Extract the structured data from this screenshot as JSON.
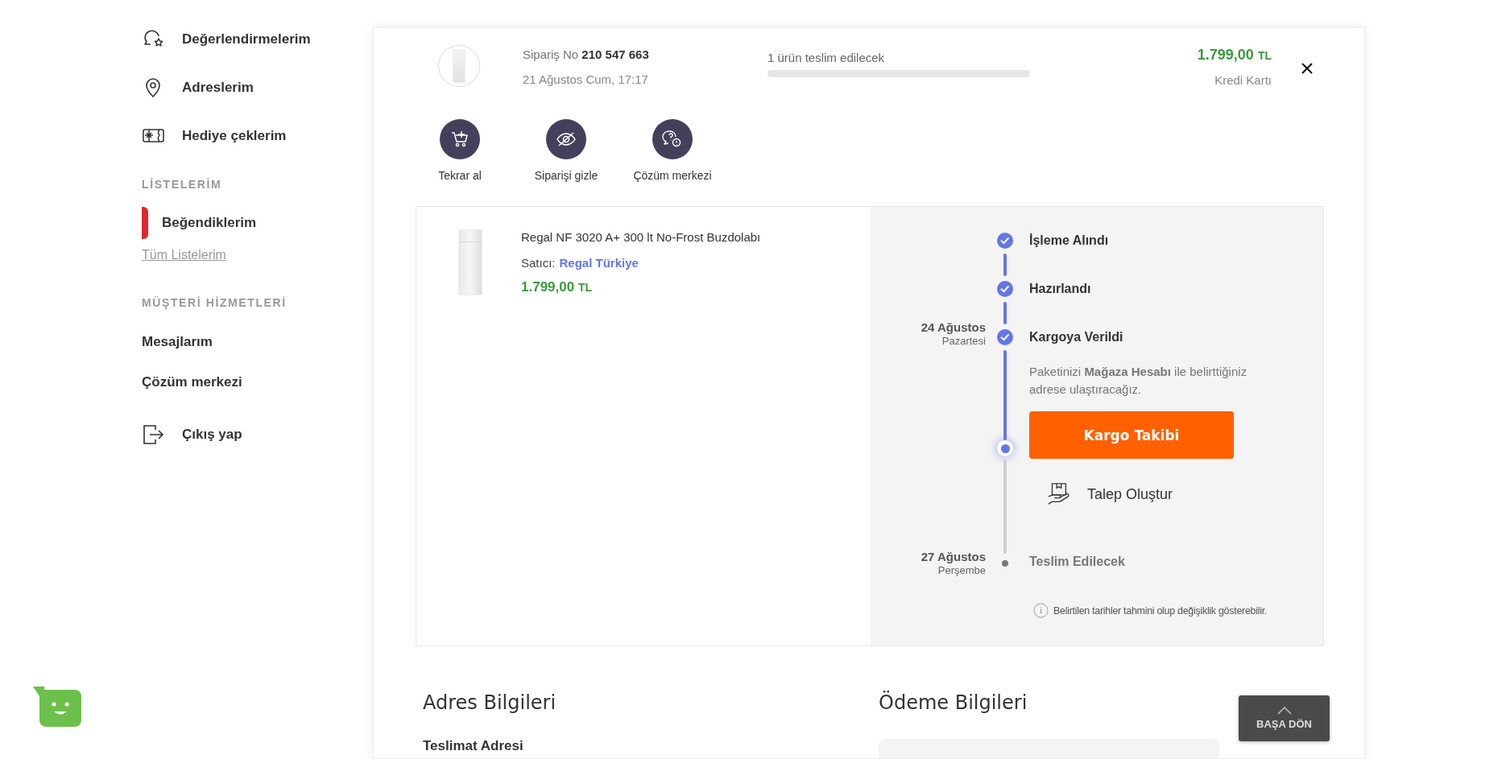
{
  "sidebar": [
    {
      "kind": "icon-item",
      "label": "Değerlendirmelerim"
    },
    {
      "kind": "icon-item",
      "label": "Adreslerim"
    },
    {
      "kind": "icon-item",
      "label": "Hediye çeklerim"
    },
    {
      "kind": "heading",
      "label": "LİSTELERİM"
    },
    {
      "kind": "list",
      "label": "Beğendiklerim",
      "selected": true
    },
    {
      "kind": "sublink",
      "label": "Tüm Listelerim"
    },
    {
      "kind": "heading",
      "label": "MÜŞTERİ HİZMETLERİ"
    },
    {
      "kind": "item",
      "label": "Mesajlarım"
    },
    {
      "kind": "item",
      "label": "Çözüm merkezi"
    },
    {
      "kind": "icon-item",
      "label": "Çıkış yap"
    }
  ],
  "order": {
    "number_label": "Sipariş No",
    "number": "210 547 663",
    "date": "21 Ağustos Cum, 17:17",
    "delivery_text": "1 ürün teslim edilecek",
    "level": 0,
    "total": "1.799,00",
    "currency": "TL",
    "payment": "Kredi Kartı",
    "actions": [
      {
        "label": "Tekrar al"
      },
      {
        "label": "Siparişi gizle"
      },
      {
        "label": "Çözüm merkezi"
      }
    ]
  },
  "product": {
    "title": "Regal NF 3020 A+ 300 lt No-Frost Buzdolabı",
    "seller_label": "Satıcı:",
    "seller": "Regal Türkiye",
    "price": "1.799,00",
    "currency": "TL"
  },
  "timeline": {
    "steps": [
      {
        "label": "İşleme Alındı",
        "done": true
      },
      {
        "label": "Hazırlandı",
        "done": true
      },
      {
        "label": "Kargoya Verildi",
        "done": true,
        "date": "24 Ağustos",
        "weekday": "Pazartesi",
        "current": true,
        "description": "Paketinizi **Mağaza Hesabı** ile belirttiğiniz adrese ulaştıracağız.",
        "button": "Kargo Takibi",
        "link": "Talep Oluştur"
      },
      {
        "label": "Teslim Edilecek",
        "done": false,
        "date": "27 Ağustos",
        "weekday": "Perşembe"
      }
    ],
    "note": "Belirtilen tarihler tahmini olup değişiklik gösterebilir."
  },
  "address": {
    "title": "Adres Bilgileri",
    "delivery_label": "Teslimat Adresi"
  },
  "payment": {
    "title": "Ödeme Bilgileri"
  },
  "back_to_top": "BAŞA DÖN"
}
